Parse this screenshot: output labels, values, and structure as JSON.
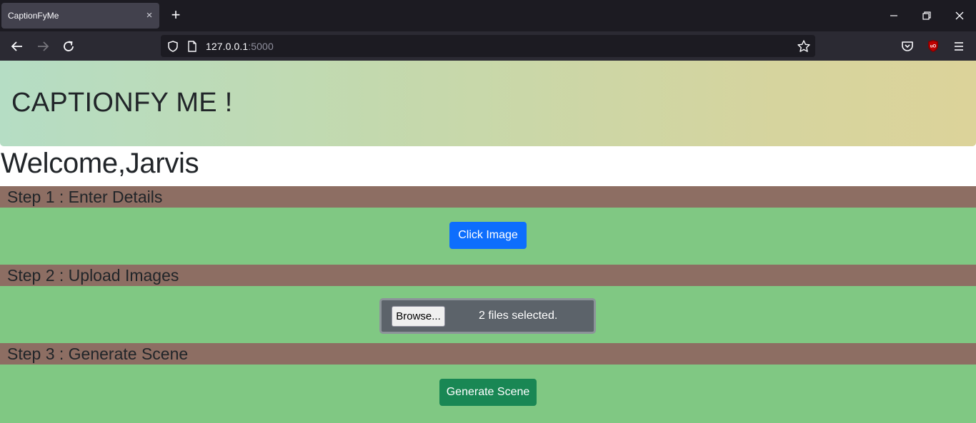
{
  "browser": {
    "tab_title": "CaptionFyMe",
    "tab_close": "×",
    "new_tab": "+",
    "url_host": "127.0.0.1",
    "url_port": ":5000"
  },
  "header": {
    "title": "CAPTIONFY ME !"
  },
  "welcome": "Welcome,Jarvis",
  "steps": [
    {
      "heading": "Step 1 : Enter Details",
      "button_label": "Click Image"
    },
    {
      "heading": "Step 2 : Upload Images",
      "browse_label": "Browse...",
      "file_status": "2 files selected."
    },
    {
      "heading": "Step 3 : Generate Scene",
      "button_label": "Generate Scene"
    }
  ],
  "colors": {
    "step_header": "#8d6e63",
    "step_body": "#80c883",
    "primary": "#0d6efd",
    "success": "#198754"
  }
}
